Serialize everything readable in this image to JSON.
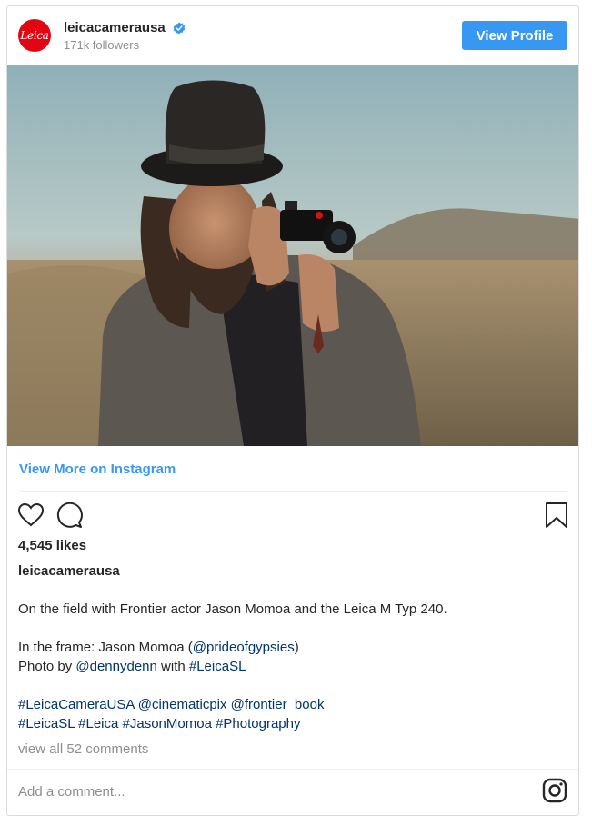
{
  "header": {
    "logo_text": "Leica",
    "username": "leicacamerausa",
    "followers": "171k followers",
    "view_profile_label": "View Profile",
    "verified_icon": "verified-badge-icon"
  },
  "post": {
    "view_more_label": "View More on Instagram",
    "likes": "4,545 likes",
    "caption_user": "leicacamerausa",
    "caption_line1": "On the field with Frontier actor Jason Momoa and the Leica M Typ 240.",
    "caption_line2_prefix": "In the frame: Jason Momoa (",
    "caption_line2_mention": "@prideofgypsies",
    "caption_line2_suffix": ")",
    "caption_line3_prefix": "Photo by ",
    "caption_line3_mention": "@dennydenn",
    "caption_line3_mid": " with ",
    "caption_line3_tag": "#LeicaSL",
    "hashtags_line1": "#LeicaCameraUSA @cinematicpix @frontier_book",
    "hashtags_line2": "#LeicaSL #Leica #JasonMomoa #Photography",
    "view_comments": "view all 52 comments",
    "add_comment_placeholder": "Add a comment..."
  },
  "icons": {
    "like": "heart-icon",
    "comment": "comment-bubble-icon",
    "save": "bookmark-icon",
    "instagram": "instagram-logo-icon"
  },
  "colors": {
    "accent": "#3897f0",
    "logo_red": "#e20612",
    "link": "#003569",
    "muted": "#8e8e8e"
  }
}
